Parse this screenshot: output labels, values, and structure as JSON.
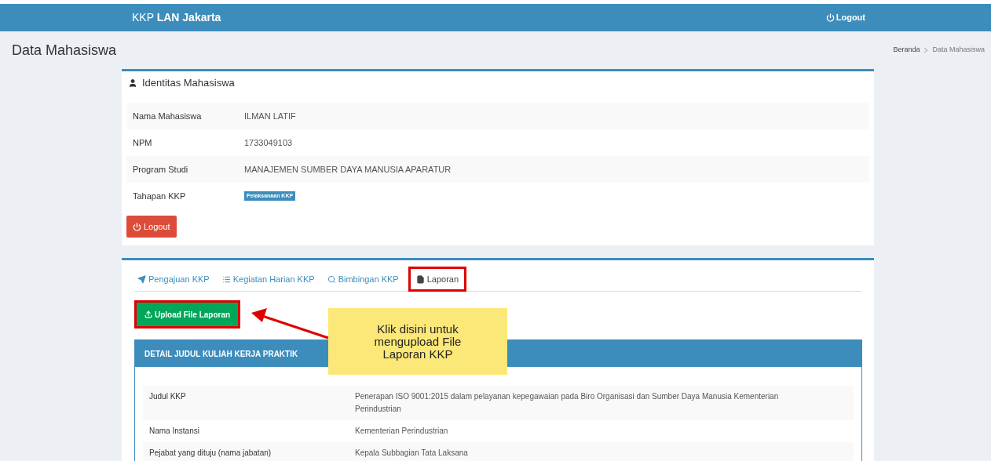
{
  "navbar": {
    "brand_prefix": "KKP",
    "brand_name": "LAN Jakarta",
    "logout": "Logout"
  },
  "page": {
    "title": "Data Mahasiswa",
    "breadcrumb": [
      "Beranda",
      "Data Mahasiswa"
    ]
  },
  "identity_card": {
    "title": "Identitas Mahasiswa",
    "rows": [
      {
        "label": "Nama Mahasiswa",
        "value": "ILMAN LATIF"
      },
      {
        "label": "NPM",
        "value": "1733049103"
      },
      {
        "label": "Program Studi",
        "value": "MANAJEMEN SUMBER DAYA MANUSIA APARATUR"
      },
      {
        "label": "Tahapan KKP",
        "value": "Pelaksanaan KKP",
        "kind": "badge"
      }
    ],
    "logout_button": "Logout"
  },
  "tabs": [
    {
      "label": "Pengajuan KKP",
      "selected": false,
      "highlighted": false
    },
    {
      "label": "Kegiatan Harian KKP",
      "selected": false,
      "highlighted": false
    },
    {
      "label": "Bimbingan KKP",
      "selected": false,
      "highlighted": false
    },
    {
      "label": "Laporan",
      "selected": true,
      "highlighted": true
    }
  ],
  "upload_button": {
    "label": "Upload File Laporan",
    "highlighted": true
  },
  "callout": {
    "text": "Klik disini untuk mengupload File Laporan KKP"
  },
  "detail": {
    "title": "DETAIL JUDUL KULIAH KERJA PRAKTIK",
    "rows": [
      {
        "label": "Judul KKP",
        "value": "Penerapan ISO 9001:2015 dalam pelayanan kepegawaian pada Biro Organisasi dan Sumber Daya Manusia Kementerian Perindustrian"
      },
      {
        "label": "Nama Instansi",
        "value": "Kementerian Perindustrian"
      },
      {
        "label": "Pejabat yang dituju (nama jabatan)",
        "value": "Kepala Subbagian Tata Laksana"
      }
    ]
  }
}
